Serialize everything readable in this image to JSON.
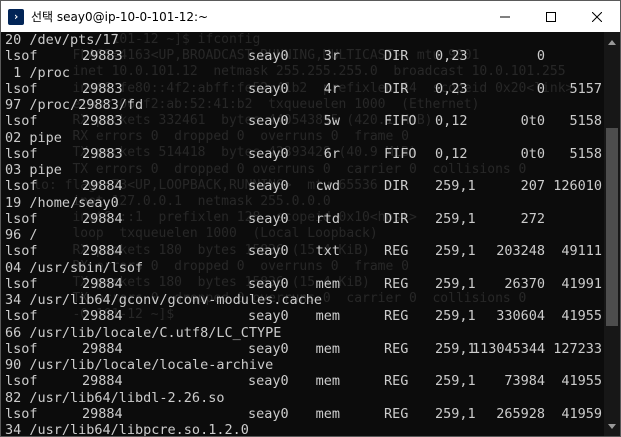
{
  "window": {
    "title": "선택 seay0@ip-10-0-101-12:~",
    "app_icon": "powershell-terminal-icon",
    "controls": {
      "minimize_icon": "minimize-icon",
      "maximize_icon": "maximize-icon",
      "close_icon": "close-icon"
    }
  },
  "colors": {
    "background": "#0c0c0c",
    "text": "#cccccc",
    "titlebar": "#ffffff",
    "scrollbar": "#171717",
    "scroll_thumb": "#4d4d4d"
  },
  "terminal": {
    "ghost_text": [
      "              101-12 ~]$ ifconfig",
      "         FLAGS=4163<UP,BROADCAST,RUNNING,MULTICAST>  mtu 9001",
      "         inet 10.0.101.12  netmask 255.255.255.0  broadcast 10.0.101.255",
      "         inet6 fe80::4f2:abff:fe52:41b2  prefixlen 64  scopeid 0x20<link>",
      "         ether 06:f2:ab:52:41:b2  txqueuelen 1000  (Ethernet)",
      "         RX packets 332461  bytes 440543895 (420.1 MiB)",
      "         RX errors 0  dropped 0  overruns 0  frame 0",
      "         TX packets 514418  bytes 42893428 (40.9 MiB)",
      "         TX errors 0  dropped 0 overruns 0  carrier 0  collisions 0",
      "",
      "    lo: flags=73<UP,LOOPBACK,RUNNING>  mtu 65536",
      "         inet 127.0.0.1  netmask 255.0.0.0",
      "         inet6 ::1  prefixlen 128  scopeid 0x10<host>",
      "         loop  txqueuelen 1000  (Local Loopback)",
      "         RX packets 180  bytes 15836 (15.4 KiB)",
      "         RX errors 0  dropped 0  overruns 0  frame 0",
      "         TX packets 180  bytes 15836 (15.4 KiB)",
      "         TX errors 0  dropped 0 overruns 0  carrier 0  collisions 0",
      "",
      "         -0-101-12 ~]$ "
    ],
    "rows": [
      {
        "kind": "path",
        "text": "20 /dev/pts/17"
      },
      {
        "kind": "lsof",
        "cmd": "lsof",
        "pid": "29883",
        "user": "seay0",
        "fd": "3r",
        "type": "DIR",
        "device": "0,23",
        "size": "0",
        "node": ""
      },
      {
        "kind": "path",
        "text": " 1 /proc"
      },
      {
        "kind": "lsof",
        "cmd": "lsof",
        "pid": "29883",
        "user": "seay0",
        "fd": "4r",
        "type": "DIR",
        "device": "0,23",
        "size": "0",
        "node": "5157"
      },
      {
        "kind": "path",
        "text": "97 /proc/29883/fd"
      },
      {
        "kind": "lsof",
        "cmd": "lsof",
        "pid": "29883",
        "user": "seay0",
        "fd": "5w",
        "type": "FIFO",
        "device": "0,12",
        "size": "0t0",
        "node": "5158"
      },
      {
        "kind": "path",
        "text": "02 pipe"
      },
      {
        "kind": "lsof",
        "cmd": "lsof",
        "pid": "29883",
        "user": "seay0",
        "fd": "6r",
        "type": "FIFO",
        "device": "0,12",
        "size": "0t0",
        "node": "5158"
      },
      {
        "kind": "path",
        "text": "03 pipe"
      },
      {
        "kind": "lsof",
        "cmd": "lsof",
        "pid": "29884",
        "user": "seay0",
        "fd": "cwd",
        "type": "DIR",
        "device": "259,1",
        "size": "207",
        "node": "126010"
      },
      {
        "kind": "path",
        "text": "19 /home/seay0"
      },
      {
        "kind": "lsof",
        "cmd": "lsof",
        "pid": "29884",
        "user": "seay0",
        "fd": "rtd",
        "type": "DIR",
        "device": "259,1",
        "size": "272",
        "node": ""
      },
      {
        "kind": "path",
        "text": "96 /"
      },
      {
        "kind": "lsof",
        "cmd": "lsof",
        "pid": "29884",
        "user": "seay0",
        "fd": "txt",
        "type": "REG",
        "device": "259,1",
        "size": "203248",
        "node": "49111"
      },
      {
        "kind": "path",
        "text": "04 /usr/sbin/lsof"
      },
      {
        "kind": "lsof",
        "cmd": "lsof",
        "pid": "29884",
        "user": "seay0",
        "fd": "mem",
        "type": "REG",
        "device": "259,1",
        "size": "26370",
        "node": "41991"
      },
      {
        "kind": "path",
        "text": "34 /usr/lib64/gconv/gconv-modules.cache"
      },
      {
        "kind": "lsof",
        "cmd": "lsof",
        "pid": "29884",
        "user": "seay0",
        "fd": "mem",
        "type": "REG",
        "device": "259,1",
        "size": "330604",
        "node": "41955"
      },
      {
        "kind": "path",
        "text": "66 /usr/lib/locale/C.utf8/LC_CTYPE"
      },
      {
        "kind": "lsof",
        "cmd": "lsof",
        "pid": "29884",
        "user": "seay0",
        "fd": "mem",
        "type": "REG",
        "device": "259,1",
        "size": "113045344",
        "node": "127233"
      },
      {
        "kind": "path",
        "text": "90 /usr/lib/locale/locale-archive"
      },
      {
        "kind": "lsof",
        "cmd": "lsof",
        "pid": "29884",
        "user": "seay0",
        "fd": "mem",
        "type": "REG",
        "device": "259,1",
        "size": "73984",
        "node": "41955"
      },
      {
        "kind": "path",
        "text": "82 /usr/lib64/libdl-2.26.so"
      },
      {
        "kind": "lsof",
        "cmd": "lsof",
        "pid": "29884",
        "user": "seay0",
        "fd": "mem",
        "type": "REG",
        "device": "259,1",
        "size": "265928",
        "node": "41959"
      },
      {
        "kind": "path",
        "text": "34 /usr/lib64/libpcre.so.1.2.0"
      }
    ]
  },
  "scrollbar": {
    "up_icon": "scroll-up-arrow-icon",
    "down_icon": "scroll-down-arrow-icon"
  }
}
